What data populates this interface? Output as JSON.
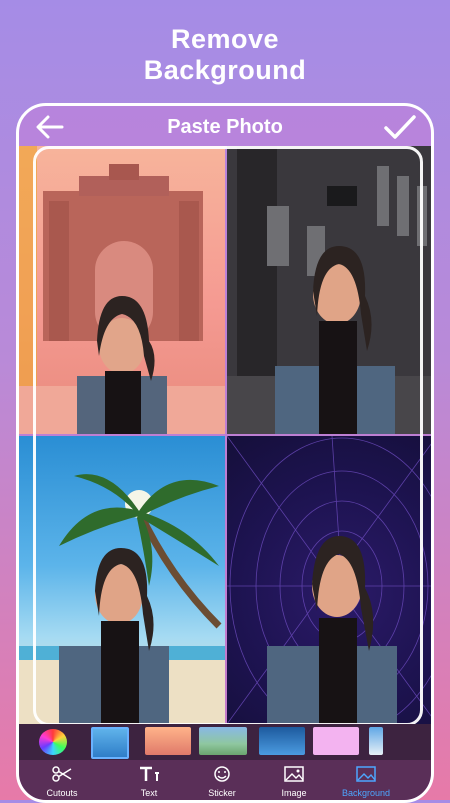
{
  "headline": {
    "line1": "Remove",
    "line2": "Background"
  },
  "screen": {
    "title": "Paste Photo",
    "back_icon": "arrow-left-icon",
    "confirm_icon": "checkmark-icon"
  },
  "grid_backgrounds": [
    "india-gate-scene",
    "city-street-scene",
    "palm-beach-scene",
    "abstract-purple-lines-scene"
  ],
  "thumbnails": [
    "color-picker",
    "blue-gradient",
    "india-gate",
    "garden",
    "doorway",
    "pink",
    "beach"
  ],
  "toolbar": {
    "items": [
      {
        "label": "Cutouts",
        "icon": "scissors-icon"
      },
      {
        "label": "Text",
        "icon": "text-icon"
      },
      {
        "label": "Sticker",
        "icon": "sticker-icon"
      },
      {
        "label": "Image",
        "icon": "image-icon"
      },
      {
        "label": "Background",
        "icon": "background-icon"
      }
    ],
    "active_index": 4
  },
  "colors": {
    "active": "#4da6ff",
    "toolbar_bg": "#5a2f58",
    "thumb_strip_bg": "#3d2340"
  }
}
